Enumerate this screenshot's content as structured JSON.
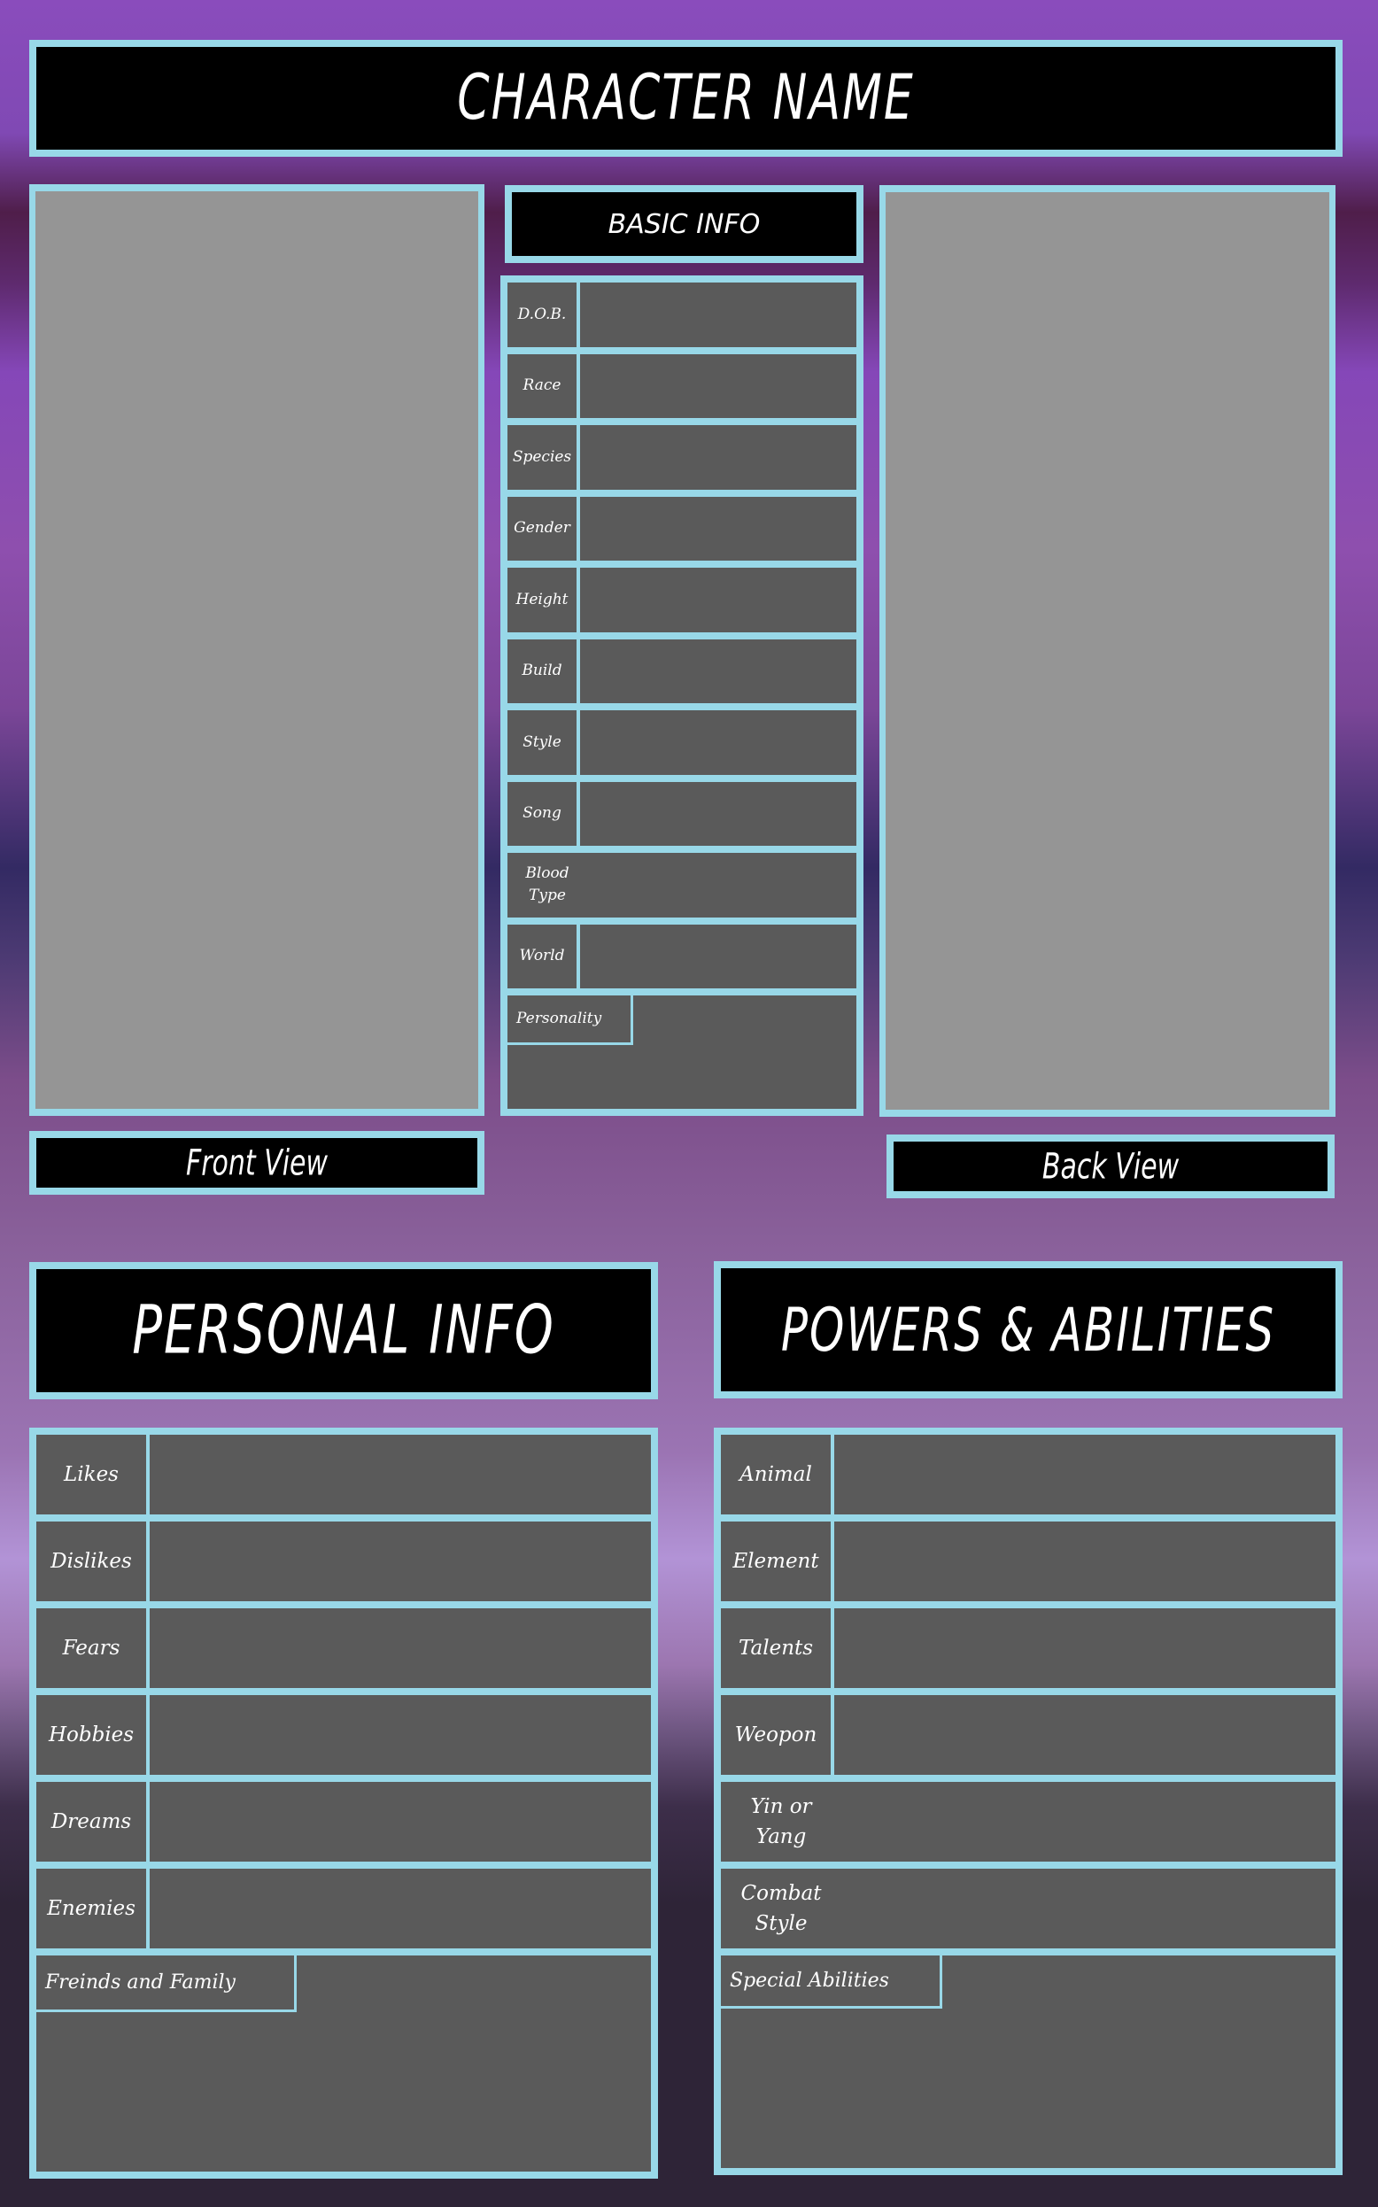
{
  "title": "CHARACTER NAME",
  "basic_info": {
    "header": "BASIC INFO",
    "rows": [
      {
        "label": "D.O.B.",
        "value": ""
      },
      {
        "label": "Race",
        "value": ""
      },
      {
        "label": "Species",
        "value": ""
      },
      {
        "label": "Gender",
        "value": ""
      },
      {
        "label": "Height",
        "value": ""
      },
      {
        "label": "Build",
        "value": ""
      },
      {
        "label": "Style",
        "value": ""
      },
      {
        "label": "Song",
        "value": ""
      },
      {
        "label": "Blood Type",
        "value": ""
      },
      {
        "label": "World",
        "value": ""
      }
    ],
    "personality_label": "Personality",
    "personality_value": ""
  },
  "views": {
    "front_label": "Front View",
    "back_label": "Back View"
  },
  "personal_info": {
    "header": "PERSONAL INFO",
    "rows": [
      {
        "label": "Likes",
        "value": ""
      },
      {
        "label": "Dislikes",
        "value": ""
      },
      {
        "label": "Fears",
        "value": ""
      },
      {
        "label": "Hobbies",
        "value": ""
      },
      {
        "label": "Dreams",
        "value": ""
      },
      {
        "label": "Enemies",
        "value": ""
      }
    ],
    "friends_label": "Freinds and Family",
    "friends_value": ""
  },
  "powers": {
    "header": "POWERS & ABILITIES",
    "rows": [
      {
        "label": "Animal",
        "value": ""
      },
      {
        "label": "Element",
        "value": ""
      },
      {
        "label": "Talents",
        "value": ""
      },
      {
        "label": "Weopon",
        "value": ""
      },
      {
        "label": "Yin or Yang",
        "value": ""
      },
      {
        "label": "Combat Style",
        "value": ""
      }
    ],
    "special_label": "Special Abilities",
    "special_value": ""
  },
  "colors": {
    "border": "#98d8e8",
    "cell": "#5a5a5a",
    "photo": "#959595",
    "header_bg": "#000000"
  }
}
